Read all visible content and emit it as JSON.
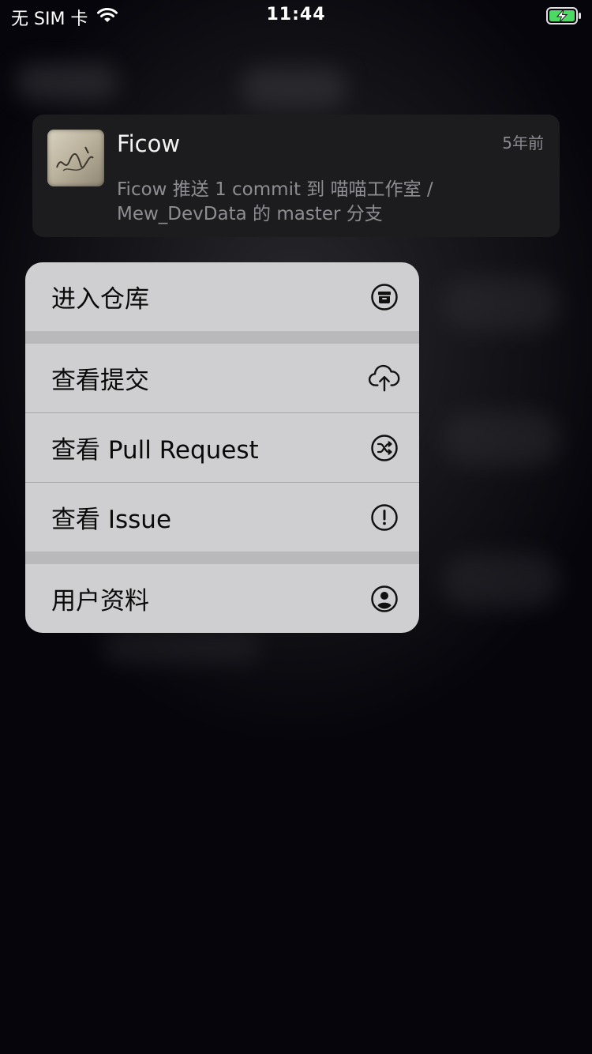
{
  "status_bar": {
    "carrier": "无 SIM 卡",
    "time": "11:44",
    "battery_icon": "battery-charging-icon",
    "wifi_icon": "wifi-icon"
  },
  "notification": {
    "title": "Ficow",
    "time": "5年前",
    "body": "Ficow 推送 1 commit 到 喵喵工作室 / Mew_DevData 的 master 分支",
    "avatar_icon": "avatar-image"
  },
  "menu": {
    "items": [
      {
        "label": "进入仓库",
        "icon": "archive-icon"
      },
      {
        "label": "查看提交",
        "icon": "cloud-upload-icon"
      },
      {
        "label": "查看 Pull Request",
        "icon": "shuffle-icon"
      },
      {
        "label": "查看 Issue",
        "icon": "exclamation-icon"
      },
      {
        "label": "用户资料",
        "icon": "user-circle-icon"
      }
    ]
  },
  "colors": {
    "background": "#05040a",
    "card": "#1c1c1f",
    "menu": "#cfcfd1",
    "battery_green": "#4cd964"
  }
}
